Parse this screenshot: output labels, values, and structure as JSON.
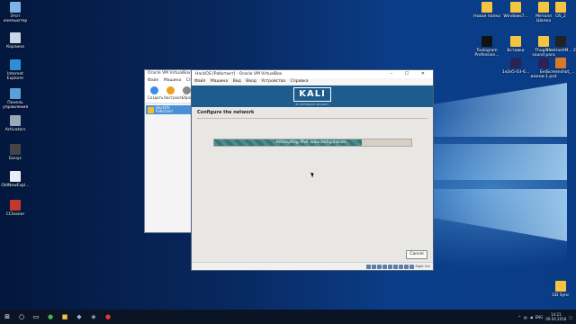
{
  "desktop": {
    "left_icons": [
      {
        "label": "Этот компьютер",
        "icon": "computer-icon",
        "color": "#7fb2e6"
      },
      {
        "label": "Корзина",
        "icon": "recycle-bin-icon",
        "color": "#c9d6e8"
      },
      {
        "label": "Internet Explorer",
        "icon": "ie-icon",
        "color": "#2f8fd6"
      },
      {
        "label": "Панель управления",
        "icon": "control-panel-icon",
        "color": "#5aa1d8"
      },
      {
        "label": "Activators",
        "icon": "folder-icon",
        "color": "#9aa9b8"
      },
      {
        "label": "Бонус",
        "icon": "bonus-icon",
        "color": "#444"
      },
      {
        "label": "OldNewExpl...",
        "icon": "explorer-icon",
        "color": "#e8eef6"
      },
      {
        "label": "CCleaner",
        "icon": "ccleaner-icon",
        "color": "#c0392b"
      }
    ],
    "right_icons": [
      {
        "label": "Новая папка",
        "icon": "folder-icon",
        "color": "#f5c542"
      },
      {
        "label": "Windows7...",
        "icon": "folder-icon",
        "color": "#f5c542"
      },
      {
        "label": "Металл Шапка",
        "icon": "folder-icon",
        "color": "#f5c542"
      },
      {
        "label": "OS_2",
        "icon": "folder-icon",
        "color": "#f5c542"
      },
      {
        "label": "Toologram Profession...",
        "icon": "app-icon",
        "color": "#111"
      },
      {
        "label": "Вставки",
        "icon": "folder-icon",
        "color": "#f5c542"
      },
      {
        "label": "Thug life sound para",
        "icon": "folder-icon",
        "color": "#f5c542"
      },
      {
        "label": "NiceHashM... 2",
        "icon": "app-icon",
        "color": "#222"
      },
      {
        "label": "1e2e5-03-6...",
        "icon": "photoshop-icon",
        "color": "#2a2456"
      },
      {
        "label": "Без имени-1.psd",
        "icon": "photoshop-icon",
        "color": "#2a2456"
      },
      {
        "label": "Screenshot_...",
        "icon": "image-icon",
        "color": "#d77a2a"
      },
      {
        "label": "GD Sync",
        "icon": "folder-icon",
        "color": "#f5c542"
      }
    ]
  },
  "vbox_manager": {
    "title": "Oracle VM VirtualBox",
    "menu": [
      "Файл",
      "Машина",
      "Справ"
    ],
    "toolbar": [
      {
        "label": "Создать",
        "color": "#3a8ee6"
      },
      {
        "label": "Настроить",
        "color": "#f0a020"
      },
      {
        "label": "Сбро",
        "color": "#888"
      }
    ],
    "vm": {
      "name": "HackOS",
      "state": "Работает"
    }
  },
  "vm_window": {
    "title": "HackOS [Работает] - Oracle VM VirtualBox",
    "controls": "–  ☐  ✕",
    "menu": [
      "Файл",
      "Машина",
      "Вид",
      "Ввод",
      "Устройства",
      "Справка"
    ],
    "banner_logo": "KALI",
    "banner_sub": "BY OFFENSIVE SECURITY",
    "heading": "Configure the network",
    "progress_text": "Attempting IPv6 autoconfiguration...",
    "progress": 0.75,
    "cancel_label": "Cancel",
    "host_key": "Right Ctrl",
    "colors": {
      "banner": "#1d5c8c",
      "progress": "#4a8f8f"
    }
  },
  "taskbar": {
    "lang": "ENG",
    "time": "14:21",
    "date": "09.04.2018"
  }
}
